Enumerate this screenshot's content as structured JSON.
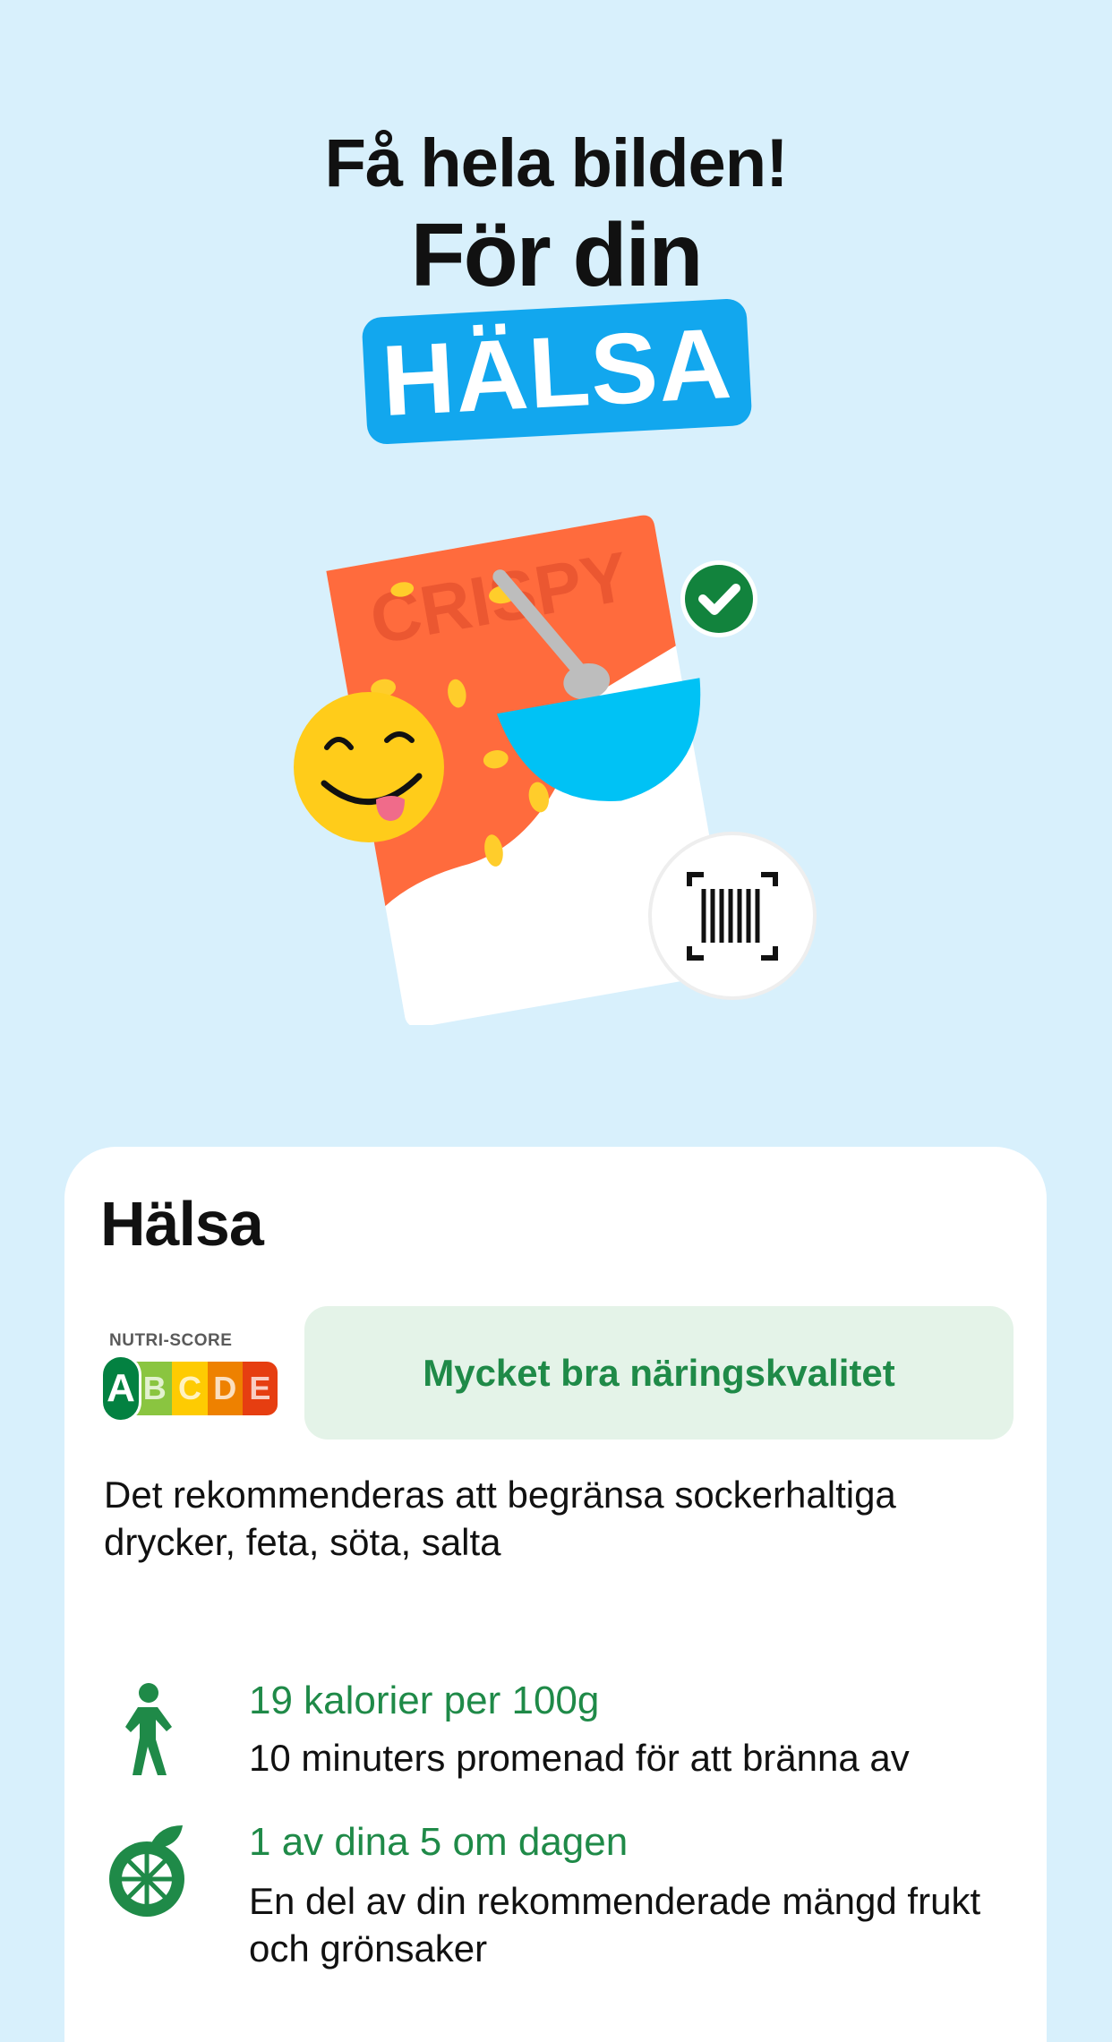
{
  "hero": {
    "headline": "Få hela bilden!",
    "subhead": "För din",
    "tag": "HÄLSA"
  },
  "illustration": {
    "box_text": "CRISPY",
    "icons": [
      "cereal-box",
      "check-icon",
      "yum-emoji-icon",
      "barcode-scan-icon",
      "bowl-icon",
      "spoon-icon"
    ]
  },
  "card": {
    "title": "Hälsa",
    "nutri_score": {
      "label": "NUTRI-SCORE",
      "grades": [
        "A",
        "B",
        "C",
        "D",
        "E"
      ],
      "selected": "A",
      "quality_text": "Mycket bra näringskvalitet"
    },
    "advice": "Det rekommenderas att begränsa sockerhaltiga drycker, feta, söta, salta",
    "items": [
      {
        "icon": "walking-person-icon",
        "title": "19 kalorier per 100g",
        "text": "10 minuters promenad för att bränna av"
      },
      {
        "icon": "fruit-icon",
        "title": "1 av dina 5 om dagen",
        "text": "En del av din rekommenderade mängd frukt och grönsaker"
      }
    ]
  },
  "colors": {
    "background": "#d8f0fc",
    "accent_blue": "#12a7ee",
    "green_text": "#1f8a48",
    "box_orange": "#ff6b3d",
    "bowl_blue": "#00c2f5"
  }
}
